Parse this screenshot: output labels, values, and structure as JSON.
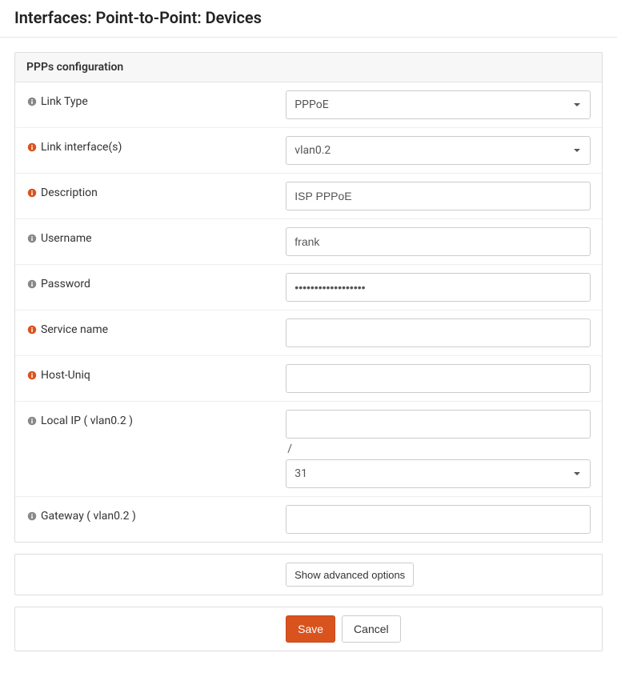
{
  "page": {
    "title": "Interfaces: Point-to-Point: Devices"
  },
  "panel": {
    "heading": "PPPs configuration",
    "fields": {
      "link_type": {
        "label": "Link Type",
        "value": "PPPoE"
      },
      "link_interfaces": {
        "label": "Link interface(s)",
        "value": "vlan0.2"
      },
      "description": {
        "label": "Description",
        "value": "ISP PPPoE"
      },
      "username": {
        "label": "Username",
        "value": "frank"
      },
      "password": {
        "label": "Password",
        "value": "••••••••••••••••••"
      },
      "service_name": {
        "label": "Service name",
        "value": ""
      },
      "host_uniq": {
        "label": "Host-Uniq",
        "value": ""
      },
      "local_ip": {
        "label": "Local IP ( vlan0.2 )",
        "value": "",
        "subnet": "31"
      },
      "gateway": {
        "label": "Gateway ( vlan0.2 )",
        "value": ""
      }
    }
  },
  "actions": {
    "show_advanced": "Show advanced options",
    "save": "Save",
    "cancel": "Cancel"
  },
  "misc": {
    "slash": "/"
  }
}
